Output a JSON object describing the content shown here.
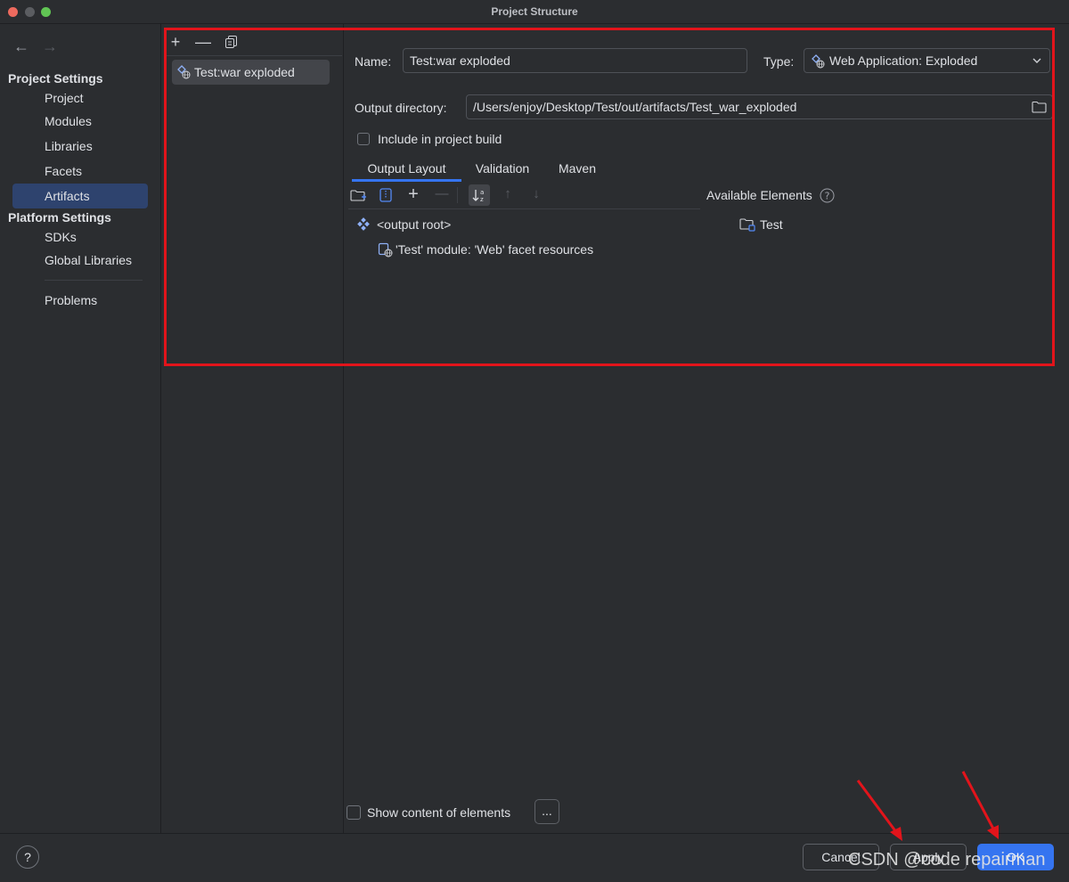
{
  "window": {
    "title": "Project Structure"
  },
  "sidebar": {
    "project_settings_header": "Project Settings",
    "project_items": [
      {
        "label": "Project"
      },
      {
        "label": "Modules"
      },
      {
        "label": "Libraries"
      },
      {
        "label": "Facets"
      },
      {
        "label": "Artifacts",
        "selected": true
      }
    ],
    "platform_settings_header": "Platform Settings",
    "platform_items": [
      {
        "label": "SDKs"
      },
      {
        "label": "Global Libraries"
      }
    ],
    "problems_label": "Problems"
  },
  "artifacts": {
    "items": [
      {
        "label": "Test:war exploded",
        "icon": "web-artifact-icon",
        "selected": true
      }
    ]
  },
  "details": {
    "name_label": "Name:",
    "name_value": "Test:war exploded",
    "type_label": "Type:",
    "type_value": "Web Application: Exploded",
    "output_dir_label": "Output directory:",
    "output_dir_value": "/Users/enjoy/Desktop/Test/out/artifacts/Test_war_exploded",
    "include_build_label": "Include in project build",
    "include_build_checked": false,
    "tabs": [
      {
        "label": "Output Layout",
        "active": true
      },
      {
        "label": "Validation",
        "active": false
      },
      {
        "label": "Maven",
        "active": false
      }
    ],
    "available_elements_label": "Available Elements",
    "tree": {
      "root_label": "<output root>",
      "child_label": "'Test' module: 'Web' facet resources"
    },
    "available": [
      {
        "label": "Test"
      }
    ],
    "show_content_label": "Show content of elements",
    "show_content_checked": false,
    "ellipsis_label": "..."
  },
  "footer": {
    "help_label": "?",
    "cancel_label": "Cancel",
    "apply_label": "Apply",
    "ok_label": "OK"
  },
  "watermark": "CSDN @code repairman",
  "colors": {
    "background": "#2b2d30",
    "selection": "#2e436e",
    "accent": "#3574f0",
    "highlight_box": "#e2141b"
  }
}
